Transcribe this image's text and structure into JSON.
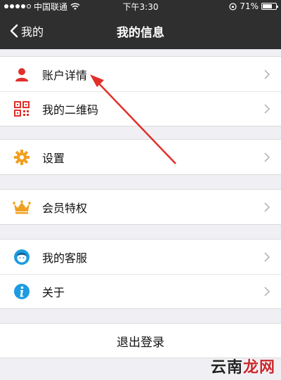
{
  "status_bar": {
    "carrier": "中国联通",
    "time": "下午3:30",
    "battery": "71%",
    "battery_level": 0.71
  },
  "nav": {
    "back_label": "我的",
    "title": "我的信息"
  },
  "groups": [
    {
      "items": [
        {
          "label": "账户详情",
          "icon": "user-icon"
        },
        {
          "label": "我的二维码",
          "icon": "qr-code-icon"
        }
      ]
    },
    {
      "items": [
        {
          "label": "设置",
          "icon": "gear-icon"
        }
      ]
    },
    {
      "items": [
        {
          "label": "会员特权",
          "icon": "crown-icon"
        }
      ]
    },
    {
      "items": [
        {
          "label": "我的客服",
          "icon": "customer-service-icon"
        },
        {
          "label": "关于",
          "icon": "info-icon"
        }
      ]
    }
  ],
  "logout_label": "退出登录",
  "watermark": {
    "part1": "云南",
    "part2": "龙网"
  },
  "colors": {
    "nav_bg": "#2f2f2f",
    "page_bg": "#efeff4",
    "accent_red": "#e0302a",
    "accent_orange": "#f0a020",
    "accent_blue": "#1e9be0"
  }
}
